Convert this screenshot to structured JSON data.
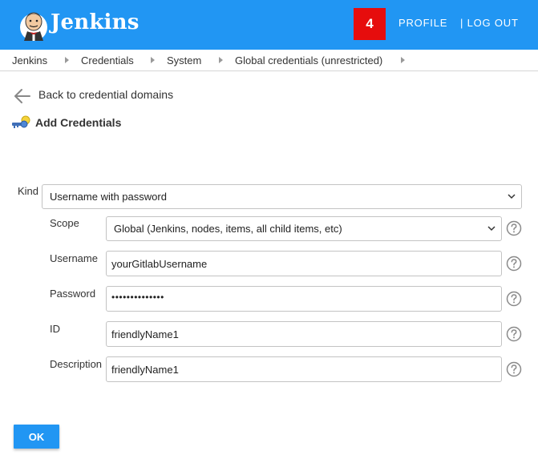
{
  "header": {
    "brand": "Jenkins",
    "notification_count": "4",
    "profile": "PROFILE",
    "logout": "| LOG OUT",
    "bg_color": "#2196f3",
    "badge_color": "#e60d0d"
  },
  "breadcrumb": [
    "Jenkins",
    "Credentials",
    "System",
    "Global credentials (unrestricted)"
  ],
  "back_link": "Back to credential domains",
  "page_title": "Add Credentials",
  "form": {
    "kind": {
      "label": "Kind",
      "value": "Username with password"
    },
    "scope": {
      "label": "Scope",
      "value": "Global (Jenkins, nodes, items, all child items, etc)"
    },
    "username": {
      "label": "Username",
      "value": "yourGitlabUsername"
    },
    "password": {
      "label": "Password",
      "value": "••••••••••••••"
    },
    "id": {
      "label": "ID",
      "value": "friendlyName1"
    },
    "description": {
      "label": "Description",
      "value": "friendlyName1"
    }
  },
  "ok_button": "OK",
  "icons": [
    "jenkins-logo-icon",
    "back-arrow-icon",
    "key-icon",
    "chevron-down-icon",
    "help-icon"
  ]
}
